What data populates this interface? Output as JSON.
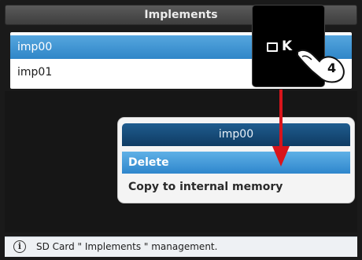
{
  "window": {
    "title": "Implements"
  },
  "list": {
    "items": [
      {
        "label": "imp00",
        "selected": true
      },
      {
        "label": "imp01",
        "selected": false
      }
    ]
  },
  "popup": {
    "title": "imp00",
    "options": [
      {
        "label": "Delete",
        "selected": true
      },
      {
        "label": "Copy to internal memory",
        "selected": false
      }
    ]
  },
  "overlay": {
    "key_label": "K",
    "step_number": "4",
    "arrow_color": "#d8141b"
  },
  "status": {
    "icon": "info-icon",
    "icon_glyph": "i",
    "text": "SD Card \" Implements \" management."
  },
  "colors": {
    "selection_blue": "#2f86c8",
    "popup_header": "#0f3b63",
    "accent_red": "#d8141b"
  }
}
